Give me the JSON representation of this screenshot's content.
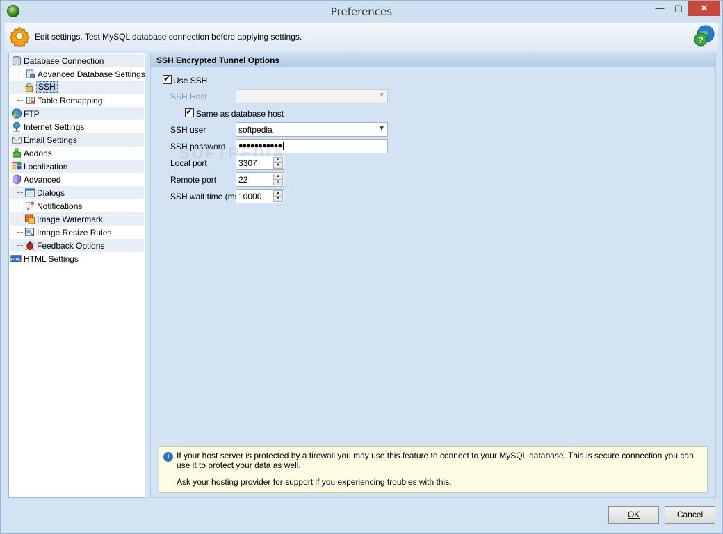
{
  "window": {
    "title": "Preferences",
    "minimize": "—",
    "maximize": "▢",
    "close": "✕"
  },
  "header": {
    "hint": "Edit settings. Test MySQL database connection before applying settings."
  },
  "tree": [
    {
      "label": "Database Connection",
      "icon": "database-icon"
    },
    {
      "label": "Advanced Database Settings",
      "icon": "database-settings-icon"
    },
    {
      "label": "SSH",
      "icon": "lock-icon",
      "selected": true
    },
    {
      "label": "Table Remapping",
      "icon": "table-icon"
    },
    {
      "label": "FTP",
      "icon": "globe-icon"
    },
    {
      "label": "Internet Settings",
      "icon": "network-icon"
    },
    {
      "label": "Email Settings",
      "icon": "envelope-icon"
    },
    {
      "label": "Addons",
      "icon": "puzzle-icon"
    },
    {
      "label": "Localization",
      "icon": "flags-icon"
    },
    {
      "label": "Advanced",
      "icon": "shield-icon"
    },
    {
      "label": "Dialogs",
      "icon": "window-icon"
    },
    {
      "label": "Notifications",
      "icon": "bell-icon"
    },
    {
      "label": "Image Watermark",
      "icon": "image-icon"
    },
    {
      "label": "Image Resize Rules",
      "icon": "resize-icon"
    },
    {
      "label": "Feedback Options",
      "icon": "bug-icon"
    },
    {
      "label": "HTML Settings",
      "icon": "html-icon"
    }
  ],
  "panel": {
    "title": "SSH Encrypted Tunnel Options",
    "use_ssh_label": "Use SSH",
    "use_ssh_checked": true,
    "ssh_host_label": "SSH Host",
    "ssh_host_value": "",
    "same_host_label": "Same as database host",
    "same_host_checked": true,
    "ssh_user_label": "SSH user",
    "ssh_user_value": "softpedia",
    "ssh_password_label": "SSH password",
    "ssh_password_value": "●●●●●●●●●●●",
    "local_port_label": "Local port",
    "local_port_value": "3307",
    "remote_port_label": "Remote port",
    "remote_port_value": "22",
    "wait_time_label": "SSH wait time (ms)",
    "wait_time_value": "10000"
  },
  "watermark": "SOFTPEDIA",
  "info": {
    "line1": "If your host server is protected by a firewall you may use this feature to connect to your MySQL database. This is secure connection you can use it to protect your data as well.",
    "line2": "Ask your hosting provider for support if you experiencing troubles with this."
  },
  "buttons": {
    "ok": "OK",
    "cancel": "Cancel"
  }
}
